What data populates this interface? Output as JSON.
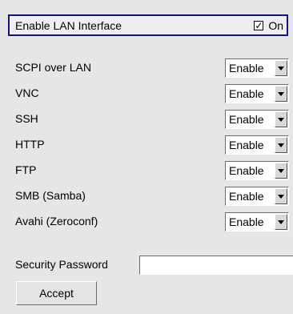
{
  "lan": {
    "label": "Enable LAN Interface",
    "checked": true,
    "check_label": "On",
    "check_mark": "✓"
  },
  "services": [
    {
      "label": "SCPI over LAN",
      "value": "Enable"
    },
    {
      "label": "VNC",
      "value": "Enable"
    },
    {
      "label": "SSH",
      "value": "Enable"
    },
    {
      "label": "HTTP",
      "value": "Enable"
    },
    {
      "label": "FTP",
      "value": "Enable"
    },
    {
      "label": "SMB (Samba)",
      "value": "Enable"
    },
    {
      "label": "Avahi (Zeroconf)",
      "value": "Enable"
    }
  ],
  "security": {
    "label": "Security Password",
    "value": ""
  },
  "accept_label": "Accept"
}
